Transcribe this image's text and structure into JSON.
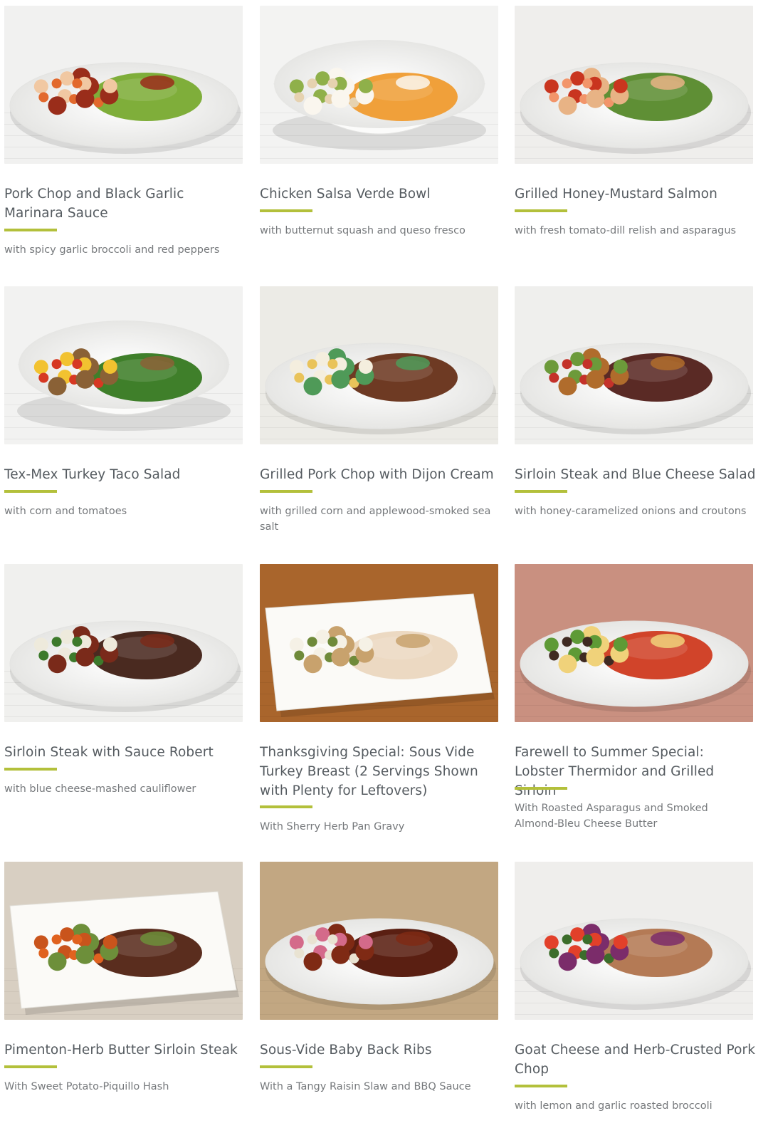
{
  "meals": [
    {
      "title": "Pork Chop and Black Garlic Marinara Sauce",
      "subtitle": "with spicy garlic broccoli and red peppers",
      "photo": {
        "plate": "round",
        "bg": "#f1f1f0",
        "foods": [
          "#7fae3a",
          "#e2692d",
          "#f1c8a2",
          "#9a2d1a"
        ]
      }
    },
    {
      "title": "Chicken Salsa Verde Bowl",
      "subtitle": "with butternut squash and queso fresco",
      "photo": {
        "plate": "bowl",
        "bg": "#f3f3f2",
        "foods": [
          "#f0a03a",
          "#e6d2b0",
          "#8fb04a",
          "#faf6ee"
        ]
      }
    },
    {
      "title": "Grilled Honey-Mustard Salmon",
      "subtitle": "with fresh tomato-dill relish and asparagus",
      "photo": {
        "plate": "round",
        "bg": "#efeeec",
        "foods": [
          "#5f8f35",
          "#f2956a",
          "#c9351f",
          "#e8b385"
        ]
      }
    },
    {
      "title": "Tex-Mex Turkey Taco Salad",
      "subtitle": "with corn and tomatoes",
      "photo": {
        "plate": "bowl",
        "bg": "#f2f2f1",
        "foods": [
          "#3f7f2a",
          "#d63823",
          "#f2c230",
          "#8a6136"
        ]
      }
    },
    {
      "title": "Grilled Pork Chop with Dijon Cream",
      "subtitle": "with grilled corn and applewood-smoked sea salt",
      "photo": {
        "plate": "round",
        "bg": "#ecebe6",
        "foods": [
          "#6e3a23",
          "#e9c35a",
          "#f4eede",
          "#4f9a58"
        ]
      }
    },
    {
      "title": "Sirloin Steak and Blue Cheese Salad",
      "subtitle": "with honey-caramelized onions and croutons",
      "photo": {
        "plate": "round",
        "bg": "#efefed",
        "foods": [
          "#5a2a25",
          "#c4322a",
          "#6c9a3a",
          "#b06c2c"
        ]
      }
    },
    {
      "title": "Sirloin Steak with Sauce Robert",
      "subtitle": "with blue cheese-mashed cauliflower",
      "photo": {
        "plate": "round",
        "bg": "#f0f0ee",
        "foods": [
          "#4a2a20",
          "#3d7a2c",
          "#eeeadc",
          "#7a2a1a"
        ]
      }
    },
    {
      "title": "Thanksgiving Special: Sous Vide Turkey Breast (2 Servings Shown with Plenty for Leftovers)",
      "subtitle": "With Sherry Herb Pan Gravy",
      "photo": {
        "plate": "platter",
        "bg": "#a9652c",
        "foods": [
          "#ecd9c2",
          "#6f8a3a",
          "#f5f1e6",
          "#c8a26d"
        ]
      }
    },
    {
      "title": "Farewell to Summer Special: Lobster Thermidor and Grilled Sirloin",
      "subtitle": "With Roasted Asparagus and Smoked Almond-Bleu Cheese Butter",
      "photo": {
        "plate": "round",
        "bg": "#c99080",
        "foods": [
          "#d1442a",
          "#3f2a22",
          "#5e9a36",
          "#f0d27a"
        ]
      }
    },
    {
      "title": "Pimenton-Herb Butter Sirloin Steak",
      "subtitle": "With Sweet Potato-Piquillo Hash",
      "photo": {
        "plate": "square",
        "bg": "#d8cfc2",
        "foods": [
          "#5a2d1e",
          "#e0621f",
          "#c9541c",
          "#6d8f3a"
        ]
      }
    },
    {
      "title": "Sous-Vide Baby Back Ribs",
      "subtitle": "With a Tangy Raisin Slaw and BBQ Sauce",
      "photo": {
        "plate": "round",
        "bg": "#c2a782",
        "foods": [
          "#5a1f12",
          "#e9e3d2",
          "#d46a8a",
          "#7f2a14"
        ]
      }
    },
    {
      "title": "Goat Cheese and Herb-Crusted Pork Chop",
      "subtitle": "with lemon and garlic roasted broccoli",
      "photo": {
        "plate": "round",
        "bg": "#efeeec",
        "foods": [
          "#b47a55",
          "#3c6d2b",
          "#e2402a",
          "#7b2c6a"
        ]
      }
    }
  ]
}
